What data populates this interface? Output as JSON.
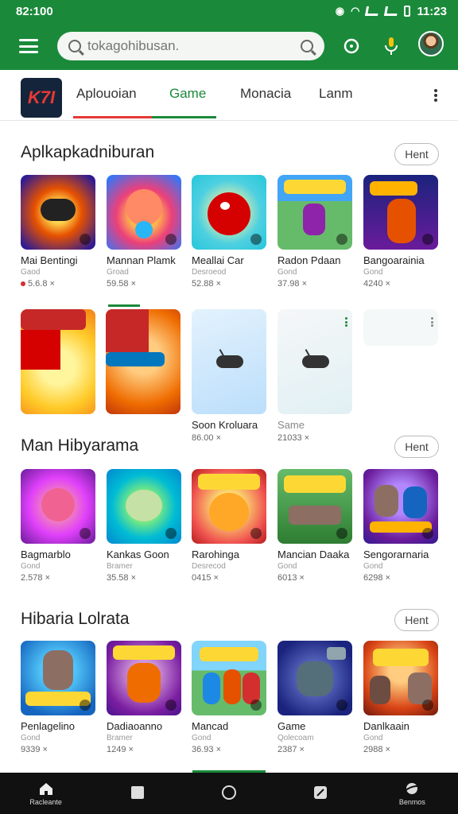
{
  "status": {
    "time": "82:100",
    "clock_right": "11:23"
  },
  "appbar": {
    "search_placeholder": "tokagohibusan.",
    "accent_color": "#1a8a3a",
    "icons": [
      "menu-icon",
      "search-icon",
      "refresh-icon",
      "mic-icon",
      "avatar"
    ]
  },
  "tabs": [
    {
      "label": "Aplouoian"
    },
    {
      "label": "Game"
    },
    {
      "label": "Monacia"
    },
    {
      "label": "Lanm"
    }
  ],
  "active_tab": "Game",
  "app_logo_text": "K7I",
  "sections": [
    {
      "title": "Aplkapkadniburan",
      "more_label": "Hent",
      "items": [
        {
          "name": "Mai Bentingi",
          "sub": "Gaod",
          "meta": "5.6.8 ×"
        },
        {
          "name": "Mannan Plamk",
          "sub": "Groad",
          "meta": "59.58 ×"
        },
        {
          "name": "Meallai Car",
          "sub": "Desroeod",
          "meta": "52.88 ×"
        },
        {
          "name": "Radon Pdaan",
          "sub": "Gond",
          "meta": "37.98 ×"
        },
        {
          "name": "Bangoarainia",
          "sub": "Gond",
          "meta": "4240 ×"
        }
      ]
    },
    {
      "title": "",
      "items": [
        {
          "name": "",
          "sub": "",
          "meta": ""
        },
        {
          "name": "",
          "sub": "",
          "meta": ""
        },
        {
          "name": "Soon Kroluara",
          "sub": "",
          "meta": "86.00 ×"
        },
        {
          "name": "Same",
          "sub": "",
          "meta": "21033 ×"
        }
      ]
    },
    {
      "title": "Man Hibyarama",
      "more_label": "Hent",
      "items": [
        {
          "name": "Bagmarblo",
          "sub": "Gond",
          "meta": "2.578 ×"
        },
        {
          "name": "Kankas Goon",
          "sub": "Bramer",
          "meta": "35.58 ×"
        },
        {
          "name": "Rarohinga",
          "sub": "Desrecod",
          "meta": "0415 ×"
        },
        {
          "name": "Mancian Daaka",
          "sub": "Gond",
          "meta": "6013 ×"
        },
        {
          "name": "Sengorarnaria",
          "sub": "Gond",
          "meta": "6298 ×"
        }
      ]
    },
    {
      "title": "Hibaria Lolrata",
      "more_label": "Hent",
      "items": [
        {
          "name": "Penlagelino",
          "sub": "Gond",
          "meta": "9339 ×"
        },
        {
          "name": "Dadiaoanno",
          "sub": "Bramer",
          "meta": "1249 ×"
        },
        {
          "name": "Mancad",
          "sub": "Gond",
          "meta": "36.93 ×"
        },
        {
          "name": "Game",
          "sub": "Qolecoam",
          "meta": "2387 ×"
        },
        {
          "name": "Danlkaain",
          "sub": "Gond",
          "meta": "2988 ×"
        }
      ]
    }
  ],
  "bottom_nav": [
    {
      "label": "Racleante",
      "icon": "home-icon"
    },
    {
      "label": "",
      "icon": "square-icon"
    },
    {
      "label": "",
      "icon": "circle-icon"
    },
    {
      "label": "",
      "icon": "edit-icon"
    },
    {
      "label": "Benmos",
      "icon": "planet-icon"
    }
  ]
}
